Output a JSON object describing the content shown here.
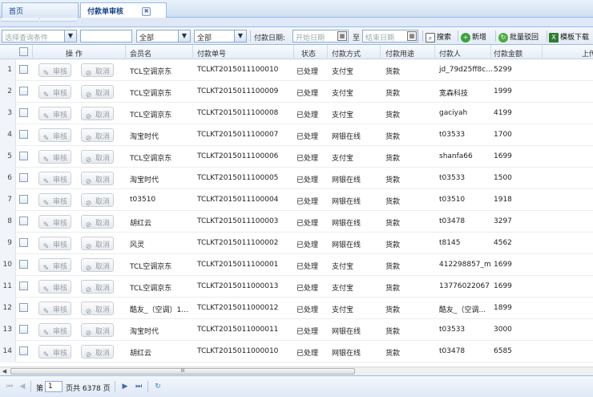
{
  "tabs": [
    {
      "label": "首页"
    },
    {
      "label": "付款单审核",
      "close": "✖"
    }
  ],
  "toolbar": {
    "query_select": "选择查询条件",
    "search_text": "",
    "select_all_1": "全部",
    "select_all_2": "全部",
    "date_label": "付款日期:",
    "start_placeholder": "开始日期",
    "to_label": "至",
    "end_placeholder": "结束日期",
    "search_btn": "搜索",
    "add_btn": "新增",
    "batch_reject_btn": "批量驳回",
    "template_download_btn": "模板下载"
  },
  "columns": {
    "action": "操 作",
    "member": "会员名",
    "order_no": "付款单号",
    "status": "状态",
    "method": "付款方式",
    "purpose": "付款用途",
    "payer": "付款人",
    "amount": "付款金额",
    "upload": "上传"
  },
  "row_buttons": {
    "audit": "审核",
    "cancel": "取消"
  },
  "rows": [
    {
      "n": "1",
      "member": "TCL空调京东",
      "order_no": "TCLKT2015011100010",
      "status": "已处理",
      "method": "支付宝",
      "purpose": "货款",
      "payer": "jd_79d25ff8c...",
      "amount": "5299"
    },
    {
      "n": "2",
      "member": "TCL空调京东",
      "order_no": "TCLKT2015011100009",
      "status": "已处理",
      "method": "支付宝",
      "purpose": "货款",
      "payer": "宽森科技",
      "amount": "1999"
    },
    {
      "n": "3",
      "member": "TCL空调京东",
      "order_no": "TCLKT2015011100008",
      "status": "已处理",
      "method": "支付宝",
      "purpose": "货款",
      "payer": "gaciyah",
      "amount": "4199"
    },
    {
      "n": "4",
      "member": "淘宝时代",
      "order_no": "TCLKT2015011100007",
      "status": "已处理",
      "method": "网银在线",
      "purpose": "货款",
      "payer": "t03533",
      "amount": "1700"
    },
    {
      "n": "5",
      "member": "TCL空调京东",
      "order_no": "TCLKT2015011100006",
      "status": "已处理",
      "method": "支付宝",
      "purpose": "货款",
      "payer": "shanfa66",
      "amount": "1699"
    },
    {
      "n": "6",
      "member": "淘宝时代",
      "order_no": "TCLKT2015011100005",
      "status": "已处理",
      "method": "网银在线",
      "purpose": "货款",
      "payer": "t03533",
      "amount": "1500"
    },
    {
      "n": "7",
      "member": "t03510",
      "order_no": "TCLKT2015011100004",
      "status": "已处理",
      "method": "网银在线",
      "purpose": "货款",
      "payer": "t03510",
      "amount": "1918"
    },
    {
      "n": "8",
      "member": "胡红云",
      "order_no": "TCLKT2015011100003",
      "status": "已处理",
      "method": "网银在线",
      "purpose": "货款",
      "payer": "t03478",
      "amount": "3297"
    },
    {
      "n": "9",
      "member": "风灵",
      "order_no": "TCLKT2015011100002",
      "status": "已处理",
      "method": "网银在线",
      "purpose": "货款",
      "payer": "t8145",
      "amount": "4562"
    },
    {
      "n": "10",
      "member": "TCL空调京东",
      "order_no": "TCLKT2015011100001",
      "status": "已处理",
      "method": "支付宝",
      "purpose": "货款",
      "payer": "412298857_m",
      "amount": "1699"
    },
    {
      "n": "11",
      "member": "TCL空调京东",
      "order_no": "TCLKT2015011000013",
      "status": "已处理",
      "method": "支付宝",
      "purpose": "货款",
      "payer": "13776022067",
      "amount": "1699"
    },
    {
      "n": "12",
      "member": "酷友_（空调）1...",
      "order_no": "TCLKT2015011000012",
      "status": "已处理",
      "method": "支付宝",
      "purpose": "货款",
      "payer": "酷友_（空调...",
      "amount": "1899"
    },
    {
      "n": "13",
      "member": "淘宝时代",
      "order_no": "TCLKT2015011000011",
      "status": "已处理",
      "method": "网银在线",
      "purpose": "货款",
      "payer": "t03533",
      "amount": "3000"
    },
    {
      "n": "14",
      "member": "胡红云",
      "order_no": "TCLKT2015011000010",
      "status": "已处理",
      "method": "网银在线",
      "purpose": "货款",
      "payer": "t03478",
      "amount": "6585"
    }
  ],
  "pager": {
    "page_prefix": "第",
    "page_value": "1",
    "page_suffix": "页共 6378 页"
  },
  "scrollbar": {
    "thumb_grip": "III"
  }
}
